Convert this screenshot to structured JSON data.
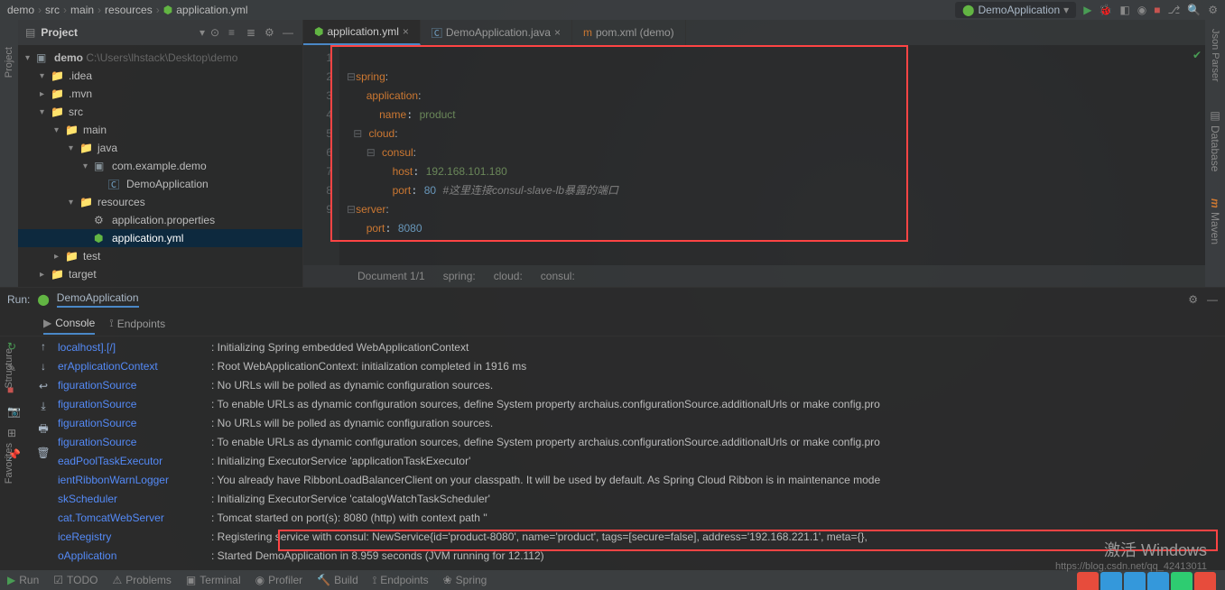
{
  "breadcrumb": [
    "demo",
    "src",
    "main",
    "resources",
    "application.yml"
  ],
  "run_config": "DemoApplication",
  "project_panel": {
    "title": "Project",
    "root": {
      "name": "demo",
      "path": "C:\\Users\\lhstack\\Desktop\\demo"
    },
    "tree": [
      {
        "indent": 1,
        "arrow": "▾",
        "icon": "folder",
        "label": ".idea"
      },
      {
        "indent": 1,
        "arrow": "▸",
        "icon": "folder",
        "label": ".mvn"
      },
      {
        "indent": 1,
        "arrow": "▾",
        "icon": "folder-src",
        "label": "src"
      },
      {
        "indent": 2,
        "arrow": "▾",
        "icon": "folder",
        "label": "main"
      },
      {
        "indent": 3,
        "arrow": "▾",
        "icon": "folder-src",
        "label": "java"
      },
      {
        "indent": 4,
        "arrow": "▾",
        "icon": "package",
        "label": "com.example.demo"
      },
      {
        "indent": 5,
        "arrow": "",
        "icon": "class",
        "label": "DemoApplication"
      },
      {
        "indent": 3,
        "arrow": "▾",
        "icon": "folder-res",
        "label": "resources"
      },
      {
        "indent": 4,
        "arrow": "",
        "icon": "props",
        "label": "application.properties"
      },
      {
        "indent": 4,
        "arrow": "",
        "icon": "yml",
        "label": "application.yml",
        "selected": true
      },
      {
        "indent": 2,
        "arrow": "▸",
        "icon": "folder",
        "label": "test"
      },
      {
        "indent": 1,
        "arrow": "▸",
        "icon": "folder",
        "label": "target"
      }
    ]
  },
  "editor": {
    "tabs": [
      {
        "label": "application.yml",
        "icon": "yml",
        "active": true,
        "dirty": true
      },
      {
        "label": "DemoApplication.java",
        "icon": "class",
        "dirty": true
      },
      {
        "label": "pom.xml (demo)",
        "icon": "maven"
      }
    ],
    "gutter": [
      "1",
      "2",
      "3",
      "4",
      "5",
      "6",
      "7",
      "8",
      "9"
    ],
    "code": {
      "l1": {
        "key": "spring",
        "colon": ":"
      },
      "l2": {
        "key": "application",
        "colon": ":"
      },
      "l3": {
        "key": "name",
        "val": "product"
      },
      "l4": {
        "key": "cloud",
        "colon": ":"
      },
      "l5": {
        "key": "consul",
        "colon": ":"
      },
      "l6": {
        "key": "host",
        "val": "192.168.101.180"
      },
      "l7": {
        "key": "port",
        "val": "80",
        "comment": "#这里连接consul-slave-lb暴露的端口"
      },
      "l8": {
        "key": "server",
        "colon": ":"
      },
      "l9": {
        "key": "port",
        "val": "8080"
      }
    },
    "breadcrumb_bottom": [
      "Document 1/1",
      "spring:",
      "cloud:",
      "consul:"
    ]
  },
  "run_panel": {
    "label": "Run:",
    "config": "DemoApplication",
    "tabs": [
      {
        "label": "Console",
        "icon": "console",
        "active": true
      },
      {
        "label": "Endpoints",
        "icon": "endpoints"
      }
    ],
    "lines": [
      {
        "src": "localhost].[/]",
        "msg": ": Initializing Spring embedded WebApplicationContext"
      },
      {
        "src": "erApplicationContext",
        "msg": ": Root WebApplicationContext: initialization completed in 1916 ms"
      },
      {
        "src": "figurationSource",
        "msg": ": No URLs will be polled as dynamic configuration sources."
      },
      {
        "src": "figurationSource",
        "msg": ": To enable URLs as dynamic configuration sources, define System property archaius.configurationSource.additionalUrls or make config.pro"
      },
      {
        "src": "figurationSource",
        "msg": ": No URLs will be polled as dynamic configuration sources."
      },
      {
        "src": "figurationSource",
        "msg": ": To enable URLs as dynamic configuration sources, define System property archaius.configurationSource.additionalUrls or make config.pro"
      },
      {
        "src": "eadPoolTaskExecutor",
        "msg": ": Initializing ExecutorService 'applicationTaskExecutor'"
      },
      {
        "src": "ientRibbonWarnLogger",
        "msg": ": You already have RibbonLoadBalancerClient on your classpath. It will be used by default. As Spring Cloud Ribbon is in maintenance mode"
      },
      {
        "src": "skScheduler",
        "msg": ": Initializing ExecutorService 'catalogWatchTaskScheduler'"
      },
      {
        "src": "cat.TomcatWebServer",
        "msg": ": Tomcat started on port(s): 8080 (http) with context path ''"
      },
      {
        "src": "iceRegistry",
        "msg": ": Registering service with consul: NewService{id='product-8080', name='product', tags=[secure=false], address='192.168.221.1', meta={},"
      },
      {
        "src": "oApplication",
        "msg": ": Started DemoApplication in 8.959 seconds (JVM running for 12.112)"
      }
    ]
  },
  "left_labels": [
    "Project",
    "Structure",
    "Favorites"
  ],
  "right_labels": [
    "Json Parser",
    "Database",
    "Maven"
  ],
  "bottom_bar": [
    "Run",
    "TODO",
    "Problems",
    "Terminal",
    "Profiler",
    "Build",
    "Endpoints",
    "Spring"
  ],
  "watermark": {
    "line1": "激活 Windows",
    "line2": "https://blog.csdn.net/qq_42413011"
  }
}
